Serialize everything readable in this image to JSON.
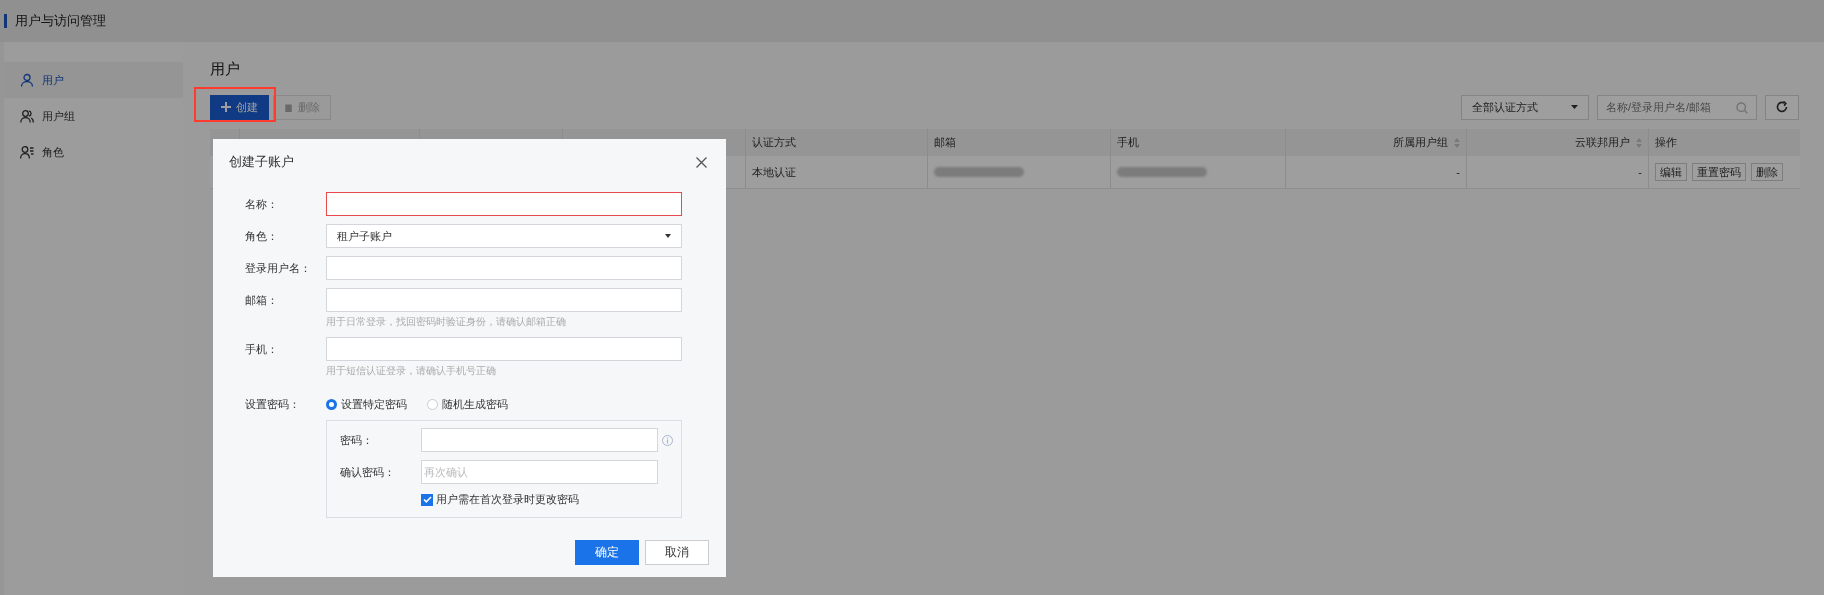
{
  "header": {
    "title": "用户与访问管理"
  },
  "sidebar": {
    "items": [
      {
        "label": "用户",
        "kind": "user",
        "selected": true
      },
      {
        "label": "用户组",
        "kind": "users",
        "selected": false
      },
      {
        "label": "角色",
        "kind": "role",
        "selected": false
      }
    ]
  },
  "page": {
    "title": "用户",
    "buttons": [
      {
        "label": "创建",
        "kind": "create",
        "disabled": false,
        "highlighted": true
      },
      {
        "label": "删除",
        "kind": "delete",
        "disabled": true,
        "highlighted": false
      }
    ],
    "filter": {
      "value": "全部认证方式"
    },
    "search": {
      "placeholder": "名称/登录用户名/邮箱"
    }
  },
  "table": {
    "columns": [
      {
        "kind": "text",
        "label": "认证方式",
        "sortable": false
      },
      {
        "kind": "text",
        "label": "邮箱",
        "sortable": false
      },
      {
        "kind": "text",
        "label": "手机",
        "sortable": false
      },
      {
        "kind": "number",
        "label": "所属用户组",
        "sortable": true
      },
      {
        "kind": "number",
        "label": "云联邦用户",
        "sortable": true
      },
      {
        "kind": "text",
        "label": "操作",
        "sortable": false
      }
    ],
    "rows": [
      {
        "cells": [
          {
            "kind": "text",
            "text": "本地认证"
          },
          {
            "kind": "redacted"
          },
          {
            "kind": "redacted"
          },
          {
            "kind": "number",
            "text": "-"
          },
          {
            "kind": "number",
            "text": "-"
          },
          {
            "kind": "actions",
            "actions": [
              "编辑",
              "重置密码",
              "删除"
            ]
          }
        ]
      }
    ]
  },
  "dialog": {
    "title": "创建子账户",
    "fields": [
      {
        "label": "名称：",
        "kind": "text",
        "error": true
      },
      {
        "label": "角色：",
        "kind": "select",
        "value": "租户子账户",
        "error": false
      },
      {
        "label": "登录用户名：",
        "kind": "text",
        "error": false
      },
      {
        "label": "邮箱：",
        "kind": "text",
        "error": false,
        "hint": "用于日常登录，找回密码时验证身份，请确认邮箱正确"
      },
      {
        "label": "手机：",
        "kind": "text",
        "error": false,
        "hint": "用于短信认证登录，请确认手机号正确"
      }
    ],
    "password": {
      "label": "设置密码：",
      "options": [
        {
          "label": "设置特定密码",
          "selected": true
        },
        {
          "label": "随机生成密码",
          "selected": false
        }
      ],
      "fields": [
        {
          "label": "密码：",
          "info": true
        },
        {
          "label": "确认密码：",
          "placeholder": "再次确认"
        }
      ],
      "force_change": {
        "label": "用户需在首次登录时更改密码",
        "checked": true
      }
    },
    "buttons": [
      {
        "label": "确定",
        "kind": "primary"
      },
      {
        "label": "取消",
        "kind": "default"
      }
    ]
  }
}
